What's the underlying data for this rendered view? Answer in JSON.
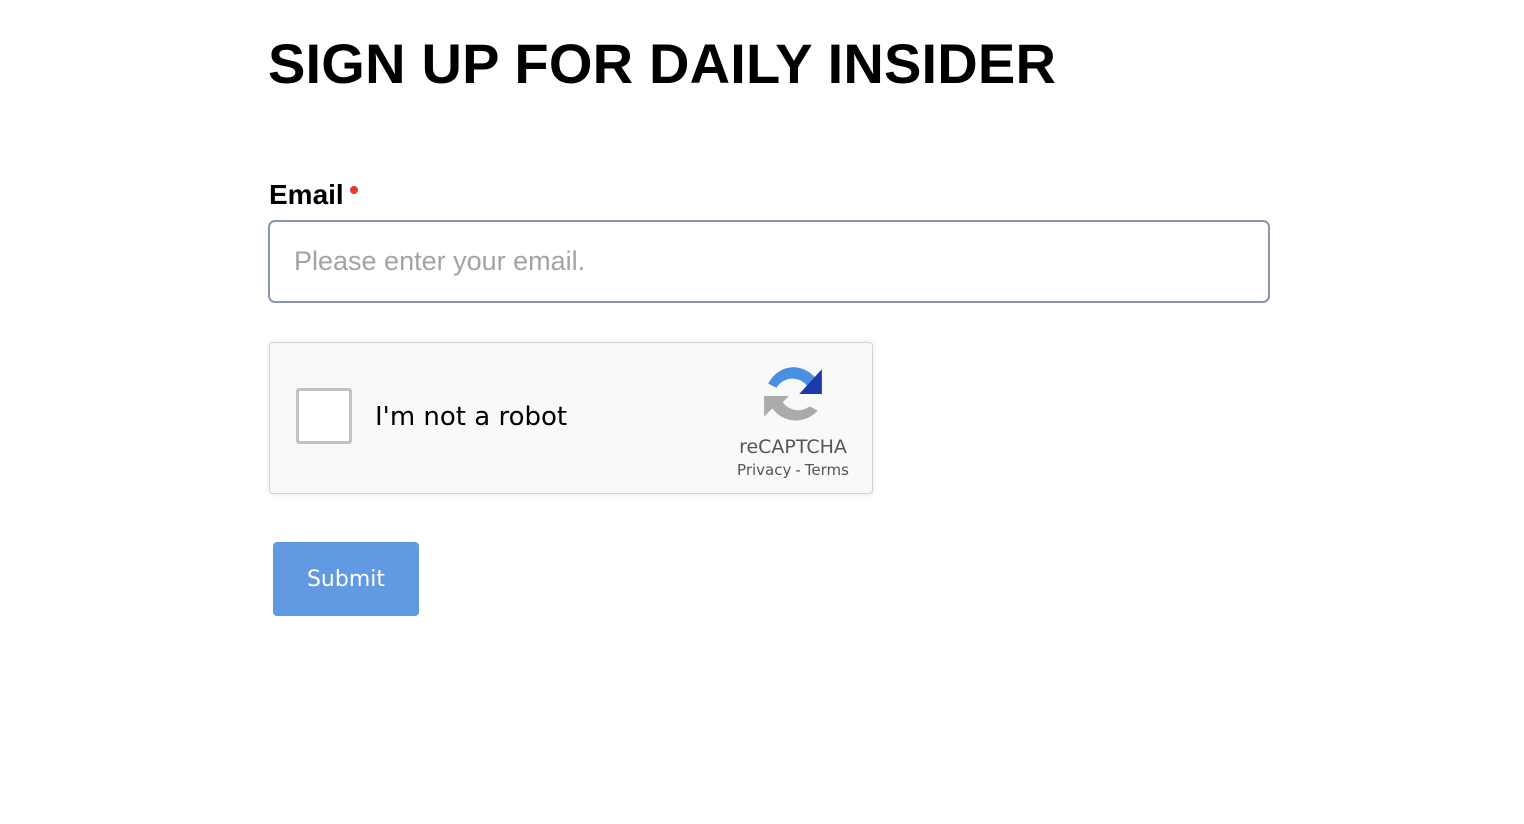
{
  "form": {
    "title": "SIGN UP FOR DAILY INSIDER",
    "email_label": "Email",
    "email_value": "",
    "email_placeholder": "Please enter your email.",
    "required_color": "#e53935",
    "submit_label": "Submit",
    "submit_color": "#6199e2"
  },
  "recaptcha": {
    "checkbox_label": "I'm not a robot",
    "checked": false,
    "brand": "reCAPTCHA",
    "privacy_label": "Privacy",
    "separator": "-",
    "terms_label": "Terms",
    "logo_icon": "recaptcha-logo-icon"
  }
}
